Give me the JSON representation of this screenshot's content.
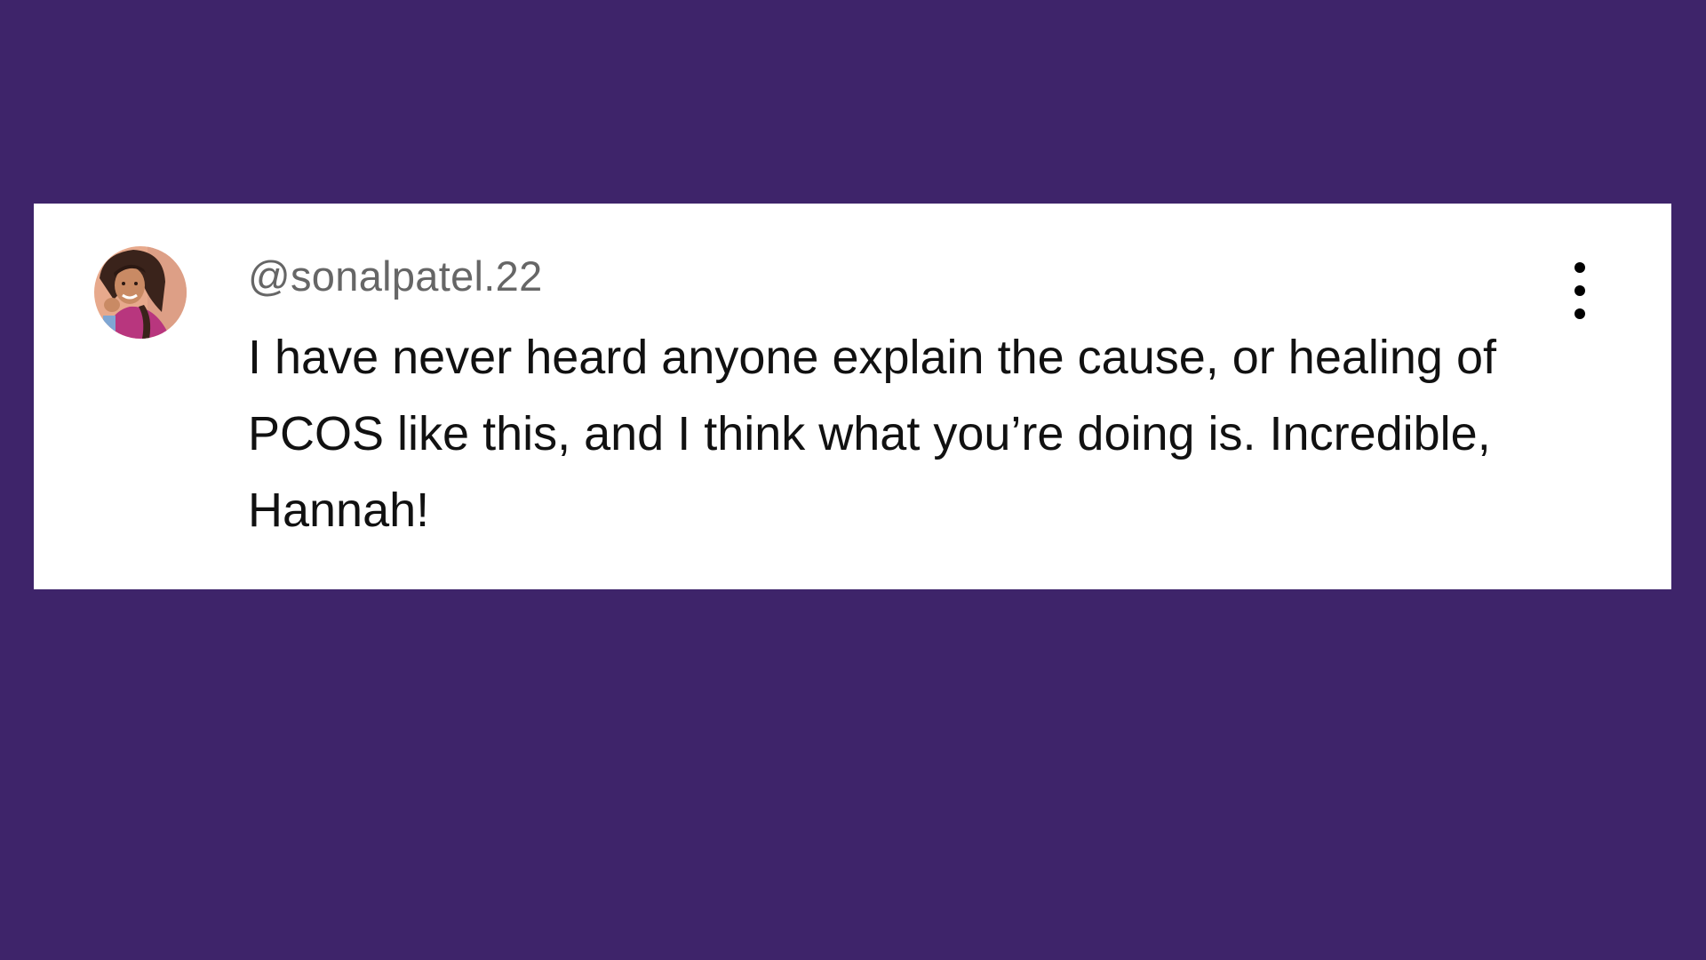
{
  "comment": {
    "username": "@sonalpatel.22",
    "text": "I have never heard anyone explain the cause, or healing of PCOS like this, and I think what you’re doing is. Incredible, Hannah!",
    "avatar_icon": "user-avatar-photo",
    "more_icon": "more-vertical-icon"
  },
  "colors": {
    "background": "#3e246a",
    "card": "#ffffff",
    "username": "#666666",
    "text": "#111111"
  }
}
